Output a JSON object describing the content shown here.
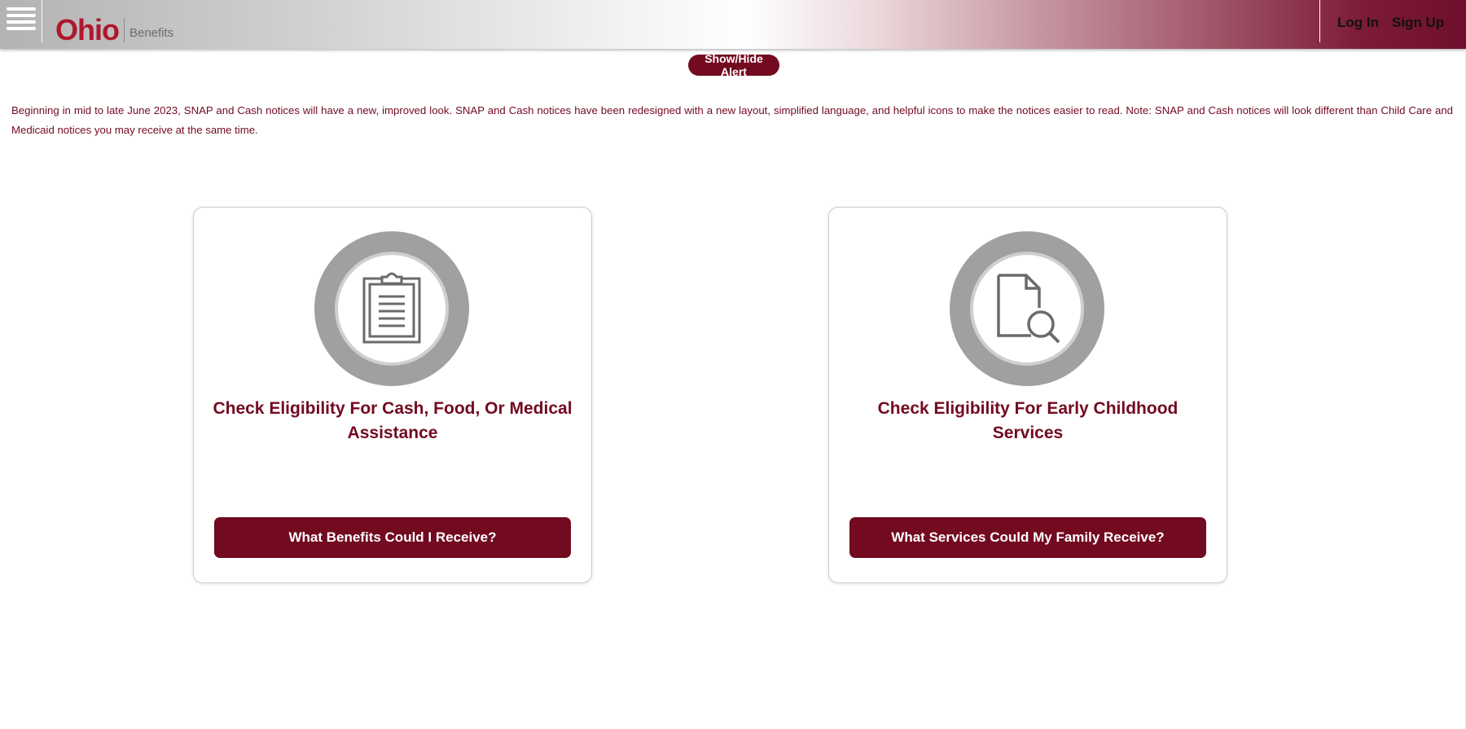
{
  "header": {
    "logo_ohio": "Ohio",
    "logo_benefits": "Benefits",
    "login_label": "Log In",
    "signup_label": "Sign Up"
  },
  "alert": {
    "toggle_label": "Show/Hide Alert",
    "message": "Beginning in mid to late June 2023, SNAP and Cash notices will have a new, improved look. SNAP and Cash notices have been redesigned with a new layout, simplified language, and helpful icons to make the notices easier to read. Note: SNAP and Cash notices will look different than Child Care and Medicaid notices you may receive at the same time."
  },
  "cards": [
    {
      "icon": "clipboard-icon",
      "title": "Check Eligibility For Cash, Food, Or Medical Assistance",
      "button_label": "What Benefits Could I Receive?"
    },
    {
      "icon": "document-search-icon",
      "title": "Check Eligibility For Early Childhood Services",
      "button_label": "What Services Could My Family Receive?"
    }
  ],
  "colors": {
    "brand": "#720a20",
    "logo_red": "#b0162e",
    "icon_gray": "#a0a0a0"
  }
}
